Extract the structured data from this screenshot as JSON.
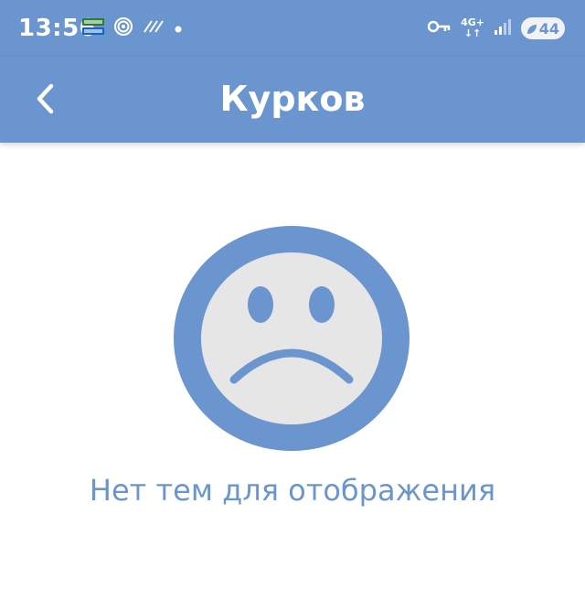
{
  "status_bar": {
    "time": "13:56",
    "left_icons": [
      "mir-sbp-icon",
      "spiral-icon",
      "hatched-icon",
      "dot-icon"
    ],
    "network": {
      "type": "4G+",
      "arrows": "↓↑"
    },
    "battery": {
      "level": "44"
    },
    "right_icons": [
      "key-icon",
      "signal-icon",
      "battery-icon"
    ]
  },
  "header": {
    "title": "Курков",
    "back_icon": "chevron-left-icon"
  },
  "empty_state": {
    "icon": "sad-face-icon",
    "message": "Нет тем для отображения"
  },
  "colors": {
    "primary": "#6a95cf",
    "face_fill": "#e6e6e6",
    "background": "#ffffff"
  }
}
